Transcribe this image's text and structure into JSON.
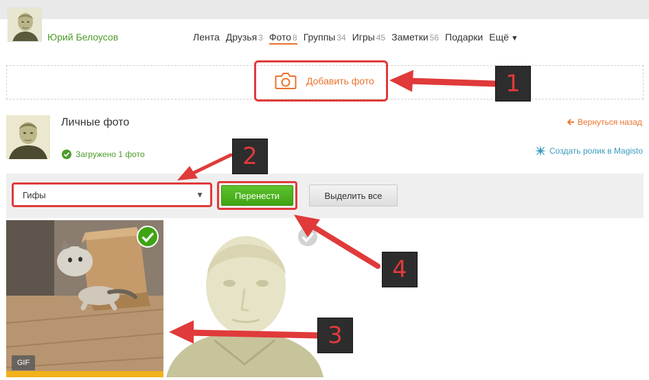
{
  "user": {
    "name": "Юрий Белоусов"
  },
  "nav": {
    "items": [
      {
        "label": "Лента",
        "count": ""
      },
      {
        "label": "Друзья",
        "count": "3"
      },
      {
        "label": "Фото",
        "count": "8"
      },
      {
        "label": "Группы",
        "count": "34"
      },
      {
        "label": "Игры",
        "count": "45"
      },
      {
        "label": "Заметки",
        "count": "56"
      },
      {
        "label": "Подарки",
        "count": ""
      },
      {
        "label": "Ещё",
        "count": "",
        "caret": "▼"
      }
    ],
    "active_index": 2
  },
  "upload": {
    "label": "Добавить фото"
  },
  "album": {
    "title": "Личные фото",
    "back_label": "Вернуться назад",
    "uploaded_label": "Загружено 1 фото",
    "magisto_label": "Создать ролик в Magisto"
  },
  "toolbar": {
    "select_value": "Гифы",
    "select_arrow": "▼",
    "move_label": "Перенести",
    "select_all_label": "Выделить все"
  },
  "photos": [
    {
      "badge": "GIF",
      "selected": true
    },
    {
      "badge": "",
      "selected": false
    }
  ],
  "callouts": [
    "1",
    "2",
    "3",
    "4"
  ],
  "colors": {
    "accent": "#eb722e",
    "green": "#4e9a2b",
    "annotation": "#e03a3a",
    "topbar": "#e9e9e9"
  }
}
